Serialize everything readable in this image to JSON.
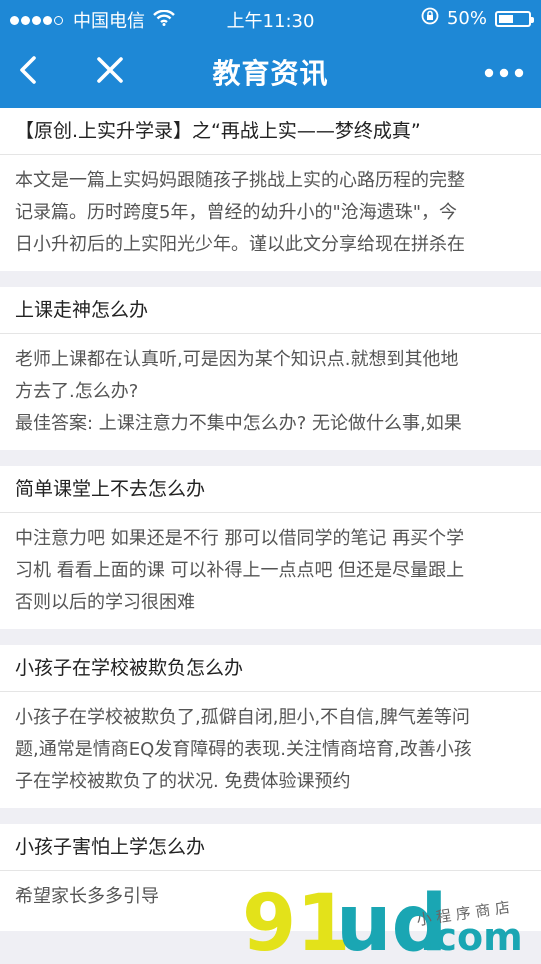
{
  "status_bar": {
    "carrier": "中国电信",
    "time": "上午11:30",
    "battery": "50%",
    "battery_level": 0.5,
    "icons": [
      "signal-dots-icon",
      "wifi-icon",
      "orientation-lock-icon",
      "battery-icon"
    ]
  },
  "nav": {
    "title": "教育资讯",
    "icons": [
      "back-chevron-icon",
      "close-icon",
      "more-icon"
    ]
  },
  "articles": [
    {
      "title": "【原创.上实升学录】之“再战上实——梦终成真”",
      "lines": [
        "本文是一篇上实妈妈跟随孩子挑战上实的心路历程的完整",
        "记录篇。历时跨度5年，曾经的幼升小的\"沧海遗珠\"，今",
        "日小升初后的上实阳光少年。谨以此文分享给现在拼杀在"
      ]
    },
    {
      "title": "上课走神怎么办",
      "lines": [
        "老师上课都在认真听,可是因为某个知识点.就想到其他地",
        "方去了.怎么办?",
        "最佳答案: 上课注意力不集中怎么办? 无论做什么事,如果"
      ]
    },
    {
      "title": "简单课堂上不去怎么办",
      "lines": [
        "中注意力吧 如果还是不行 那可以借同学的笔记 再买个学",
        "习机 看看上面的课 可以补得上一点点吧 但还是尽量跟上",
        "否则以后的学习很困难"
      ]
    },
    {
      "title": "小孩子在学校被欺负怎么办",
      "lines": [
        "小孩子在学校被欺负了,孤僻自闭,胆小,不自信,脾气差等问",
        "题,通常是情商EQ发育障碍的表现.关注情商培育,改善小孩",
        "子在学校被欺负了的状况. 免费体验课预约"
      ]
    },
    {
      "title": "小孩子害怕上学怎么办",
      "lines": [
        "希望家长多多引导"
      ]
    }
  ],
  "watermark": {
    "brand": "91ud.com",
    "tagline": "小程序商店",
    "colors": {
      "yellow": "#e3e21a",
      "teal": "#1aa6b3"
    }
  },
  "colors": {
    "header": "#1e88d6",
    "background": "#efeff4"
  }
}
